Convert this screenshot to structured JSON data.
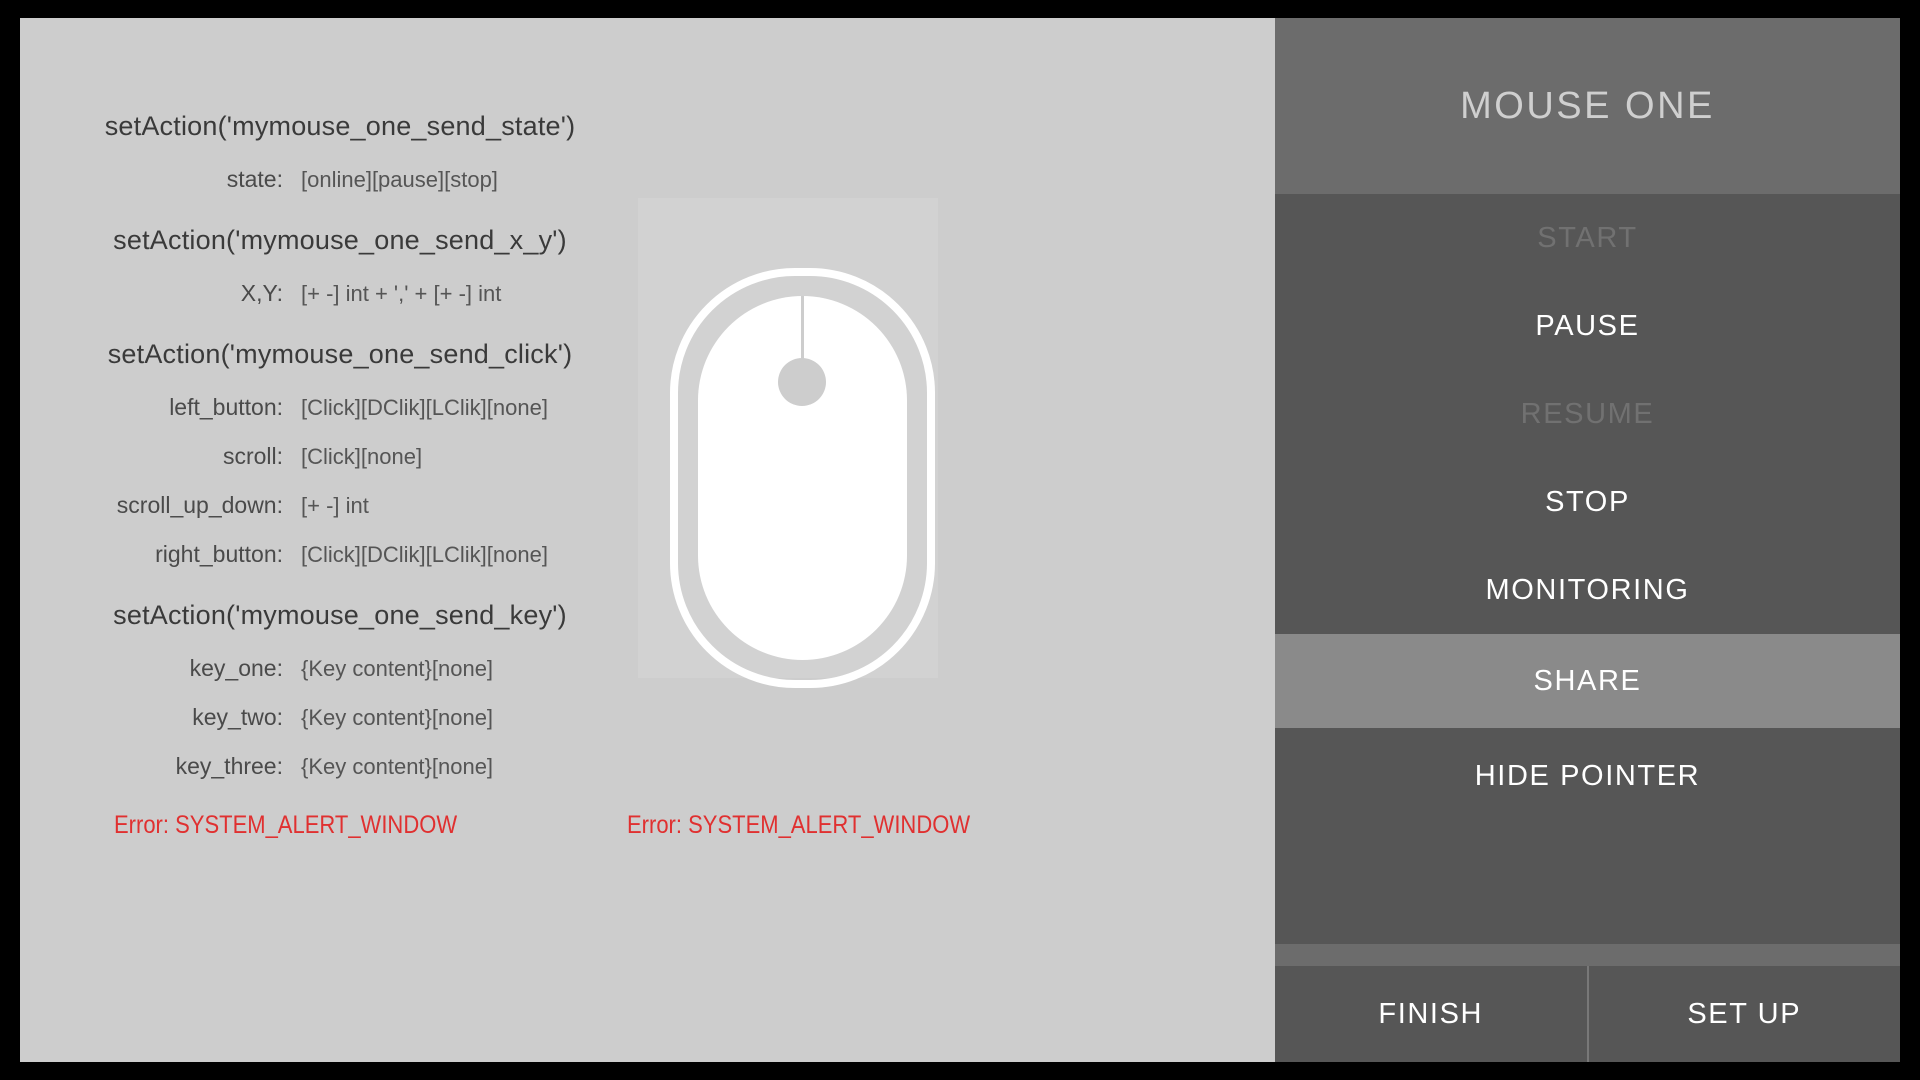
{
  "doc": {
    "sections": [
      {
        "action": "setAction('mymouse_one_send_state')",
        "rows": [
          {
            "label": "state:",
            "value": "[online][pause][stop]"
          }
        ]
      },
      {
        "action": "setAction('mymouse_one_send_x_y')",
        "rows": [
          {
            "label": "X,Y:",
            "value": "[+ -] int + ',' + [+ -] int"
          }
        ]
      },
      {
        "action": "setAction('mymouse_one_send_click')",
        "rows": [
          {
            "label": "left_button:",
            "value": "[Click][DClik][LClik][none]"
          },
          {
            "label": "scroll:",
            "value": "[Click][none]"
          },
          {
            "label": "scroll_up_down:",
            "value": "[+ -] int"
          },
          {
            "label": "right_button:",
            "value": "[Click][DClik][LClik][none]"
          }
        ]
      },
      {
        "action": "setAction('mymouse_one_send_key')",
        "rows": [
          {
            "label": "key_one:",
            "value": "{Key content}[none]"
          },
          {
            "label": "key_two:",
            "value": "{Key content}[none]"
          },
          {
            "label": "key_three:",
            "value": "{Key content}[none]"
          }
        ]
      }
    ],
    "errors": {
      "left": "Error: SYSTEM_ALERT_WINDOW",
      "center": "Error: SYSTEM_ALERT_WINDOW"
    },
    "error_color": "#e03030"
  },
  "artwork": {
    "icon": "computer-mouse-icon"
  },
  "sidebar": {
    "title": "MOUSE ONE",
    "items": [
      {
        "label": "START",
        "state": "disabled"
      },
      {
        "label": "PAUSE",
        "state": "enabled"
      },
      {
        "label": "RESUME",
        "state": "disabled"
      },
      {
        "label": "STOP",
        "state": "enabled"
      },
      {
        "label": "MONITORING",
        "state": "enabled"
      },
      {
        "label": "SHARE",
        "state": "active"
      },
      {
        "label": "HIDE POINTER",
        "state": "enabled"
      }
    ],
    "bottom_buttons": [
      {
        "label": "FINISH"
      },
      {
        "label": "SET UP"
      }
    ],
    "colors": {
      "header_bg": "#6c6c6c",
      "menu_bg": "#565656",
      "active_bg": "#8a8a8a",
      "disabled_text": "#717171",
      "text": "#ffffff"
    }
  }
}
